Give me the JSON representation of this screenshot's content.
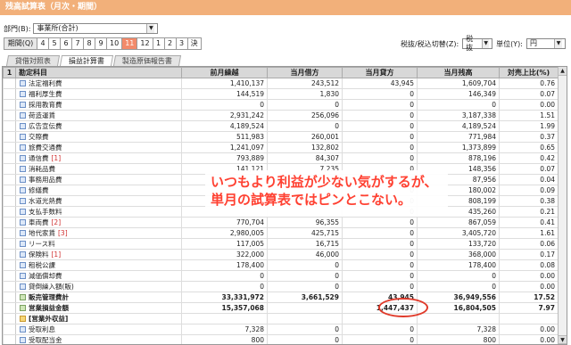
{
  "title": "残高試算表（月次・期間）",
  "filter": {
    "dept_label": "部門(B):",
    "dept_value": "事業所(合計)"
  },
  "period": {
    "label": "期間(Q)",
    "months": [
      "4",
      "5",
      "6",
      "7",
      "8",
      "9",
      "10",
      "11",
      "12",
      "1",
      "2",
      "3",
      "決"
    ],
    "selected": "11"
  },
  "controls": {
    "tax_label": "税抜/税込切替(Z):",
    "tax_value": "税抜",
    "unit_label": "単位(Y):",
    "unit_value": "円"
  },
  "tabs": [
    "貸借対照表",
    "損益計算書",
    "製造原価報告書"
  ],
  "active_tab": "損益計算書",
  "table": {
    "headers": [
      "1",
      "勘定科目",
      "前月繰越",
      "当月借方",
      "当月貸方",
      "当月残高",
      "対売上比(%)"
    ],
    "rows": [
      {
        "name": "法定福利費",
        "prev": "1,410,137",
        "debit": "243,512",
        "credit": "43,945",
        "bal": "1,609,704",
        "ratio": "0.76"
      },
      {
        "name": "福利厚生費",
        "prev": "144,519",
        "debit": "1,830",
        "credit": "0",
        "bal": "146,349",
        "ratio": "0.07"
      },
      {
        "name": "採用教育費",
        "prev": "0",
        "debit": "0",
        "credit": "0",
        "bal": "0",
        "ratio": "0.00"
      },
      {
        "name": "荷造運賃",
        "prev": "2,931,242",
        "debit": "256,096",
        "credit": "0",
        "bal": "3,187,338",
        "ratio": "1.51"
      },
      {
        "name": "広告宣伝費",
        "prev": "4,189,524",
        "debit": "0",
        "credit": "0",
        "bal": "4,189,524",
        "ratio": "1.99"
      },
      {
        "name": "交際費",
        "prev": "511,983",
        "debit": "260,001",
        "credit": "0",
        "bal": "771,984",
        "ratio": "0.37"
      },
      {
        "name": "旅費交通費",
        "prev": "1,241,097",
        "debit": "132,802",
        "credit": "0",
        "bal": "1,373,899",
        "ratio": "0.65"
      },
      {
        "name": "通信費",
        "tag": "[1]",
        "prev": "793,889",
        "debit": "84,307",
        "credit": "0",
        "bal": "878,196",
        "ratio": "0.42"
      },
      {
        "name": "消耗品費",
        "prev": "141,121",
        "debit": "7,235",
        "credit": "0",
        "bal": "148,356",
        "ratio": "0.07"
      },
      {
        "name": "事務用品費",
        "prev": "",
        "debit": "",
        "credit": "0",
        "bal": "87,956",
        "ratio": "0.04"
      },
      {
        "name": "修繕費",
        "prev": "",
        "debit": "",
        "credit": "0",
        "bal": "180,002",
        "ratio": "0.09"
      },
      {
        "name": "水道光熱費",
        "prev": "",
        "debit": "",
        "credit": "0",
        "bal": "808,199",
        "ratio": "0.38"
      },
      {
        "name": "支払手数料",
        "prev": "",
        "debit": "",
        "credit": "0",
        "bal": "435,260",
        "ratio": "0.21"
      },
      {
        "name": "車両費",
        "tag": "[2]",
        "prev": "770,704",
        "debit": "96,355",
        "credit": "0",
        "bal": "867,059",
        "ratio": "0.41"
      },
      {
        "name": "地代家賃",
        "tag": "[3]",
        "prev": "2,980,005",
        "debit": "425,715",
        "credit": "0",
        "bal": "3,405,720",
        "ratio": "1.61"
      },
      {
        "name": "リース料",
        "prev": "117,005",
        "debit": "16,715",
        "credit": "0",
        "bal": "133,720",
        "ratio": "0.06"
      },
      {
        "name": "保険料",
        "tag": "[1]",
        "prev": "322,000",
        "debit": "46,000",
        "credit": "0",
        "bal": "368,000",
        "ratio": "0.17"
      },
      {
        "name": "租税公課",
        "prev": "178,400",
        "debit": "0",
        "credit": "0",
        "bal": "178,400",
        "ratio": "0.08"
      },
      {
        "name": "減価償却費",
        "prev": "0",
        "debit": "0",
        "credit": "0",
        "bal": "0",
        "ratio": "0.00"
      },
      {
        "name": "貸倒繰入額(販)",
        "prev": "0",
        "debit": "0",
        "credit": "0",
        "bal": "0",
        "ratio": "0.00"
      }
    ],
    "totals": [
      {
        "name": "販売管理費計",
        "prev": "33,331,972",
        "debit": "3,661,529",
        "credit": "43,945",
        "bal": "36,949,556",
        "ratio": "17.52"
      },
      {
        "name": "営業損益金額",
        "prev": "15,357,068",
        "debit": "",
        "credit": "1,447,437",
        "bal": "16,804,505",
        "ratio": "7.97"
      }
    ],
    "group": {
      "name": "[営業外収益]"
    },
    "tail": [
      {
        "name": "受取利息",
        "prev": "7,328",
        "debit": "0",
        "credit": "0",
        "bal": "7,328",
        "ratio": "0.00"
      },
      {
        "name": "受取配当金",
        "prev": "800",
        "debit": "0",
        "credit": "0",
        "bal": "800",
        "ratio": "0.00"
      }
    ]
  },
  "callout": {
    "line1": "いつもより利益が少ない気がするが、",
    "line2": "単月の試算表ではピンとこない。"
  }
}
